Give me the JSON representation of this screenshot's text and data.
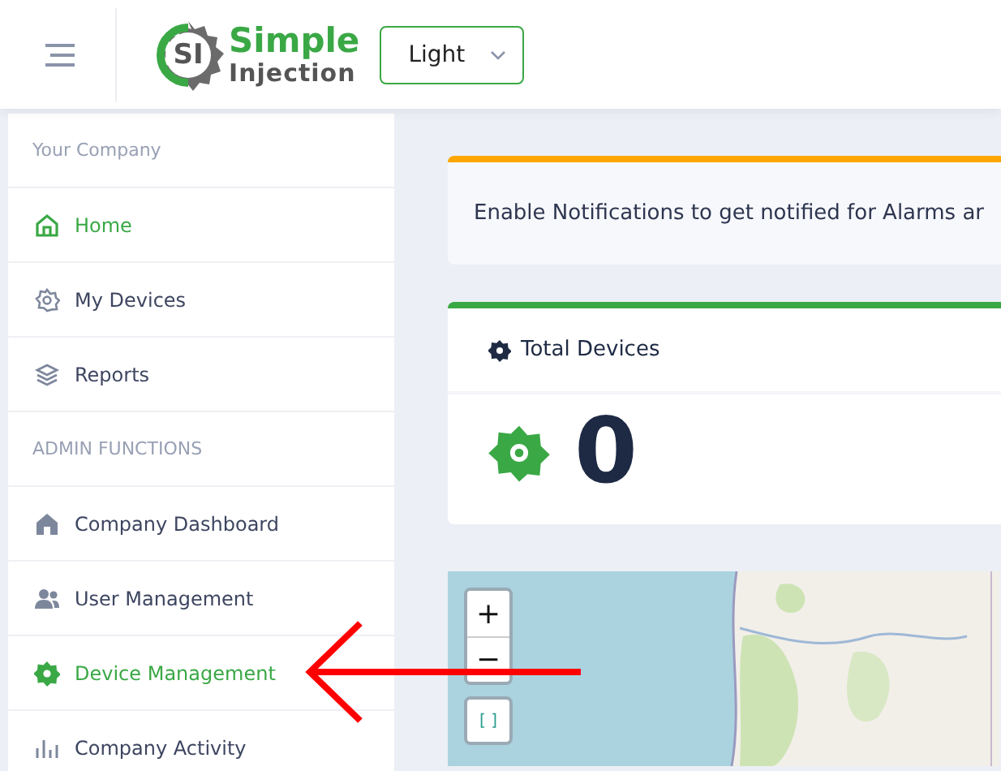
{
  "header": {
    "logo": {
      "badge": "SI",
      "name_top": "Simple",
      "name_bottom": "Injection"
    },
    "theme_select": {
      "value": "Light"
    }
  },
  "sidebar": {
    "sections": [
      {
        "title": "Your Company",
        "items": [
          {
            "label": "Home",
            "selected": true
          },
          {
            "label": "My Devices",
            "selected": false
          },
          {
            "label": "Reports",
            "selected": false
          }
        ]
      },
      {
        "title": "ADMIN FUNCTIONS",
        "items": [
          {
            "label": "Company Dashboard",
            "selected": false
          },
          {
            "label": "User Management",
            "selected": false
          },
          {
            "label": "Device Management",
            "selected": true
          },
          {
            "label": "Company Activity",
            "selected": false
          }
        ]
      }
    ]
  },
  "notification": {
    "text": "Enable Notifications to get notified for Alarms ar"
  },
  "total_devices": {
    "title": "Total Devices",
    "value": "0"
  },
  "map": {
    "controls": {
      "zoom_in": "+",
      "zoom_out": "−",
      "fullscreen": "[ ]"
    }
  }
}
